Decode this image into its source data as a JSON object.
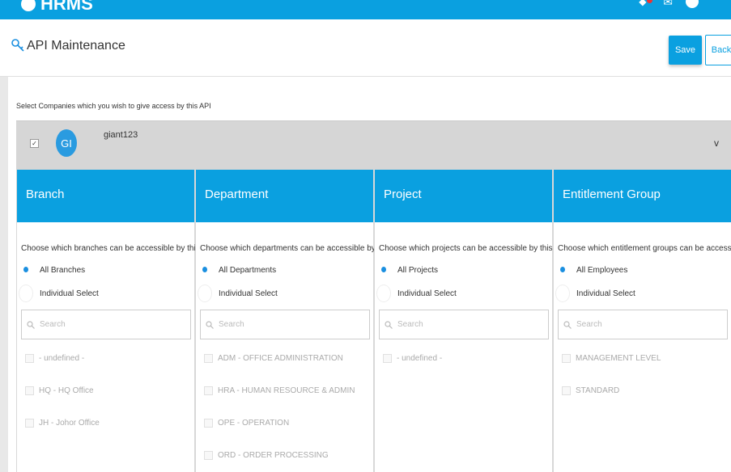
{
  "topbar": {
    "app_name": "HRMS"
  },
  "header": {
    "title": "API Maintenance",
    "save_label": "Save",
    "back_label": "Back"
  },
  "content": {
    "subtitle": "Select Companies which you wish to give access by this API",
    "company": {
      "checked": true,
      "checkbox_mark": "✓",
      "initials": "GI",
      "name": "giant123",
      "chevron": "v"
    }
  },
  "columns": [
    {
      "title": "Branch",
      "description": "Choose which branches can be accessible by this API",
      "option_all": "All Branches",
      "option_individual": "Individual Select",
      "search_placeholder": "Search",
      "items": [
        "- undefined -",
        "HQ - HQ Office",
        "JH - Johor Office"
      ]
    },
    {
      "title": "Department",
      "description": "Choose which departments can be accessible by this API",
      "option_all": "All Departments",
      "option_individual": "Individual Select",
      "search_placeholder": "Search",
      "items": [
        "ADM - OFFICE ADMINISTRATION",
        "HRA - HUMAN RESOURCE & ADMIN",
        "OPE - OPERATION",
        "ORD - ORDER PROCESSING"
      ]
    },
    {
      "title": "Project",
      "description": "Choose which projects can be accessible by this API",
      "option_all": "All Projects",
      "option_individual": "Individual Select",
      "search_placeholder": "Search",
      "items": [
        "- undefined -"
      ]
    },
    {
      "title": "Entitlement Group",
      "description": "Choose which entitlement groups can be accessible by",
      "option_all": "All Employees",
      "option_individual": "Individual Select",
      "search_placeholder": "Search",
      "items": [
        "MANAGEMENT LEVEL",
        "STANDARD"
      ]
    }
  ],
  "colors": {
    "accent": "#0aa0e0",
    "radio": "#1a8fe0",
    "avatar": "#2a9be0",
    "notification": "#e33333"
  },
  "icons": [
    "bell-icon",
    "chat-icon",
    "user-avatar-icon",
    "key-icon",
    "search-icon",
    "chevron-down-icon"
  ]
}
